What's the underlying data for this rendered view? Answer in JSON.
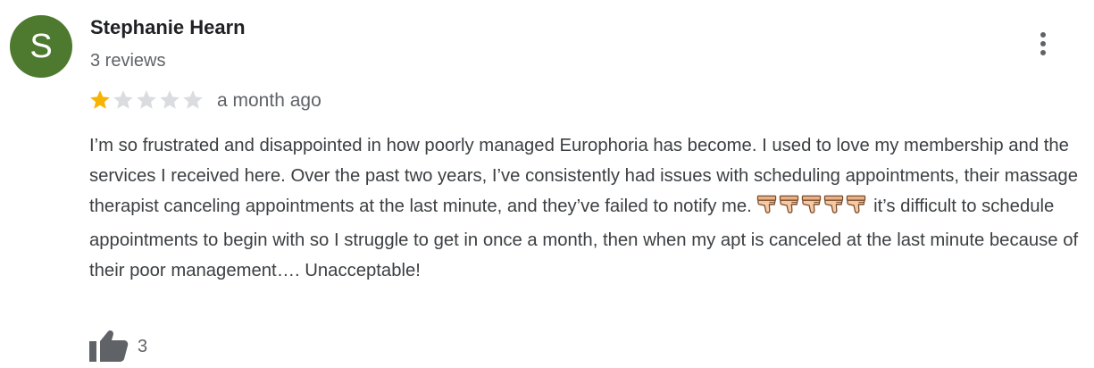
{
  "review": {
    "author": {
      "initial": "S",
      "name": "Stephanie Hearn",
      "reviews_count": "3 reviews",
      "avatar_color": "#4d7a2e"
    },
    "rating": 1,
    "rating_max": 5,
    "star_filled_color": "#f6b400",
    "star_empty_color": "#dadce0",
    "date": "a month ago",
    "text_part1": "I’m so frustrated and disappointed in how poorly managed Europhoria has become. I used to love my membership and the services I received here. Over the past two years, I’ve consistently had issues with scheduling appointments, their massage therapist canceling appointments at the last minute, and they’ve failed to notify me.",
    "inline_emoji": "thumbs-down-icon",
    "inline_emoji_count": 5,
    "text_part2": "it’s difficult to schedule appointments to begin with so I struggle to get in once a month, then when my apt is canceled at the last minute because of their poor management…. Unacceptable!",
    "likes": "3",
    "menu_icon": "more-vert-icon",
    "like_icon": "thumb-up-icon"
  }
}
